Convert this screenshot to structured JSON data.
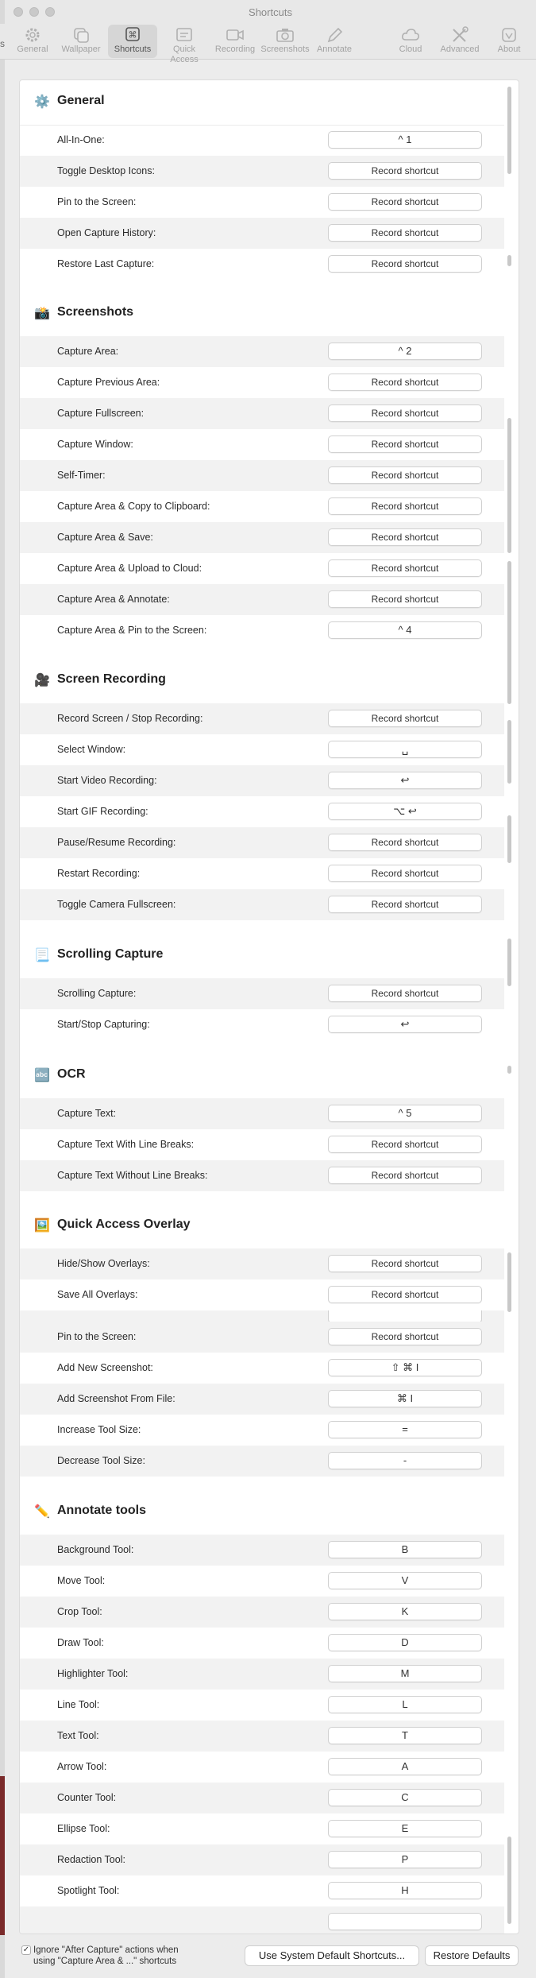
{
  "window": {
    "title": "Shortcuts"
  },
  "toolbar": {
    "edge_label": "s",
    "tabs": [
      {
        "label": "General",
        "icon": "gear-icon"
      },
      {
        "label": "Wallpaper",
        "icon": "wallpaper-icon"
      },
      {
        "label": "Shortcuts",
        "icon": "command-key-icon"
      },
      {
        "label": "Quick Access",
        "icon": "quick-access-icon"
      },
      {
        "label": "Recording",
        "icon": "video-camera-icon"
      },
      {
        "label": "Screenshots",
        "icon": "camera-icon"
      },
      {
        "label": "Annotate",
        "icon": "pencil-icon"
      },
      {
        "label": "Cloud",
        "icon": "cloud-icon"
      },
      {
        "label": "Advanced",
        "icon": "tools-icon"
      },
      {
        "label": "About",
        "icon": "app-icon"
      }
    ],
    "active_tab": "Shortcuts"
  },
  "sections": [
    {
      "title": "General",
      "icon": "⚙️",
      "rows": [
        {
          "label": "All-In-One:",
          "shortcut": "^ 1"
        },
        {
          "label": "Toggle Desktop Icons:",
          "shortcut": "Record shortcut"
        },
        {
          "label": "Pin to the Screen:",
          "shortcut": "Record shortcut"
        },
        {
          "label": "Open Capture History:",
          "shortcut": "Record shortcut"
        },
        {
          "label": "Restore Last Capture:",
          "shortcut": "Record shortcut"
        }
      ]
    },
    {
      "title": "Screenshots",
      "icon": "📸",
      "rows": [
        {
          "label": "Capture Area:",
          "shortcut": "^ 2"
        },
        {
          "label": "Capture Previous Area:",
          "shortcut": "Record shortcut"
        },
        {
          "label": "Capture Fullscreen:",
          "shortcut": "Record shortcut"
        },
        {
          "label": "Capture Window:",
          "shortcut": "Record shortcut"
        },
        {
          "label": "Self-Timer:",
          "shortcut": "Record shortcut"
        },
        {
          "label": "Capture Area & Copy to Clipboard:",
          "shortcut": "Record shortcut"
        },
        {
          "label": "Capture Area & Save:",
          "shortcut": "Record shortcut"
        },
        {
          "label": "Capture Area & Upload to Cloud:",
          "shortcut": "Record shortcut"
        },
        {
          "label": "Capture Area & Annotate:",
          "shortcut": "Record shortcut"
        },
        {
          "label": "Capture Area & Pin to the Screen:",
          "shortcut": "^ 4"
        }
      ]
    },
    {
      "title": "Screen Recording",
      "icon": "🎥",
      "rows": [
        {
          "label": "Record Screen / Stop Recording:",
          "shortcut": "Record shortcut"
        },
        {
          "label": "Select Window:",
          "shortcut": "␣"
        },
        {
          "label": "Start Video Recording:",
          "shortcut": "↩"
        },
        {
          "label": "Start GIF Recording:",
          "shortcut": "⌥ ↩"
        },
        {
          "label": "Pause/Resume Recording:",
          "shortcut": "Record shortcut"
        },
        {
          "label": "Restart Recording:",
          "shortcut": "Record shortcut"
        },
        {
          "label": "Toggle Camera Fullscreen:",
          "shortcut": "Record shortcut"
        }
      ]
    },
    {
      "title": "Scrolling Capture",
      "icon": "📃",
      "rows": [
        {
          "label": "Scrolling Capture:",
          "shortcut": "Record shortcut"
        },
        {
          "label": "Start/Stop Capturing:",
          "shortcut": "↩"
        }
      ]
    },
    {
      "title": "OCR",
      "icon": "🔤",
      "rows": [
        {
          "label": "Capture Text:",
          "shortcut": "^ 5"
        },
        {
          "label": "Capture Text With Line Breaks:",
          "shortcut": "Record shortcut"
        },
        {
          "label": "Capture Text Without Line Breaks:",
          "shortcut": "Record shortcut"
        }
      ]
    },
    {
      "title": "Quick Access Overlay",
      "icon": "🖼️",
      "rows": [
        {
          "label": "Hide/Show Overlays:",
          "shortcut": "Record shortcut"
        },
        {
          "label": "Save All Overlays:",
          "shortcut": "Record shortcut"
        },
        {
          "label": "",
          "shortcut": ""
        },
        {
          "label": "Pin to the Screen:",
          "shortcut": "Record shortcut"
        },
        {
          "label": "Add New Screenshot:",
          "shortcut": "⇧ ⌘ I"
        },
        {
          "label": "Add Screenshot From File:",
          "shortcut": "⌘ I"
        },
        {
          "label": "Increase Tool Size:",
          "shortcut": "="
        },
        {
          "label": "Decrease Tool Size:",
          "shortcut": "-"
        }
      ]
    },
    {
      "title": "Annotate tools",
      "icon": "✏️",
      "rows": [
        {
          "label": "Background Tool:",
          "shortcut": "B"
        },
        {
          "label": "Move Tool:",
          "shortcut": "V"
        },
        {
          "label": "Crop Tool:",
          "shortcut": "K"
        },
        {
          "label": "Draw Tool:",
          "shortcut": "D"
        },
        {
          "label": "Highlighter Tool:",
          "shortcut": "M"
        },
        {
          "label": "Line Tool:",
          "shortcut": "L"
        },
        {
          "label": "Text Tool:",
          "shortcut": "T"
        },
        {
          "label": "Arrow Tool:",
          "shortcut": "A"
        },
        {
          "label": "Counter Tool:",
          "shortcut": "C"
        },
        {
          "label": "Ellipse Tool:",
          "shortcut": "E"
        },
        {
          "label": "Redaction Tool:",
          "shortcut": "P"
        },
        {
          "label": "Spotlight Tool:",
          "shortcut": "H"
        },
        {
          "label": "",
          "shortcut": ""
        }
      ]
    }
  ],
  "footer": {
    "checkbox_checked": true,
    "checkbox_label": "Ignore \"After Capture\" actions when using \"Capture Area & ...\" shortcuts",
    "system_defaults_button": "Use System Default Shortcuts...",
    "restore_defaults_button": "Restore Defaults"
  }
}
